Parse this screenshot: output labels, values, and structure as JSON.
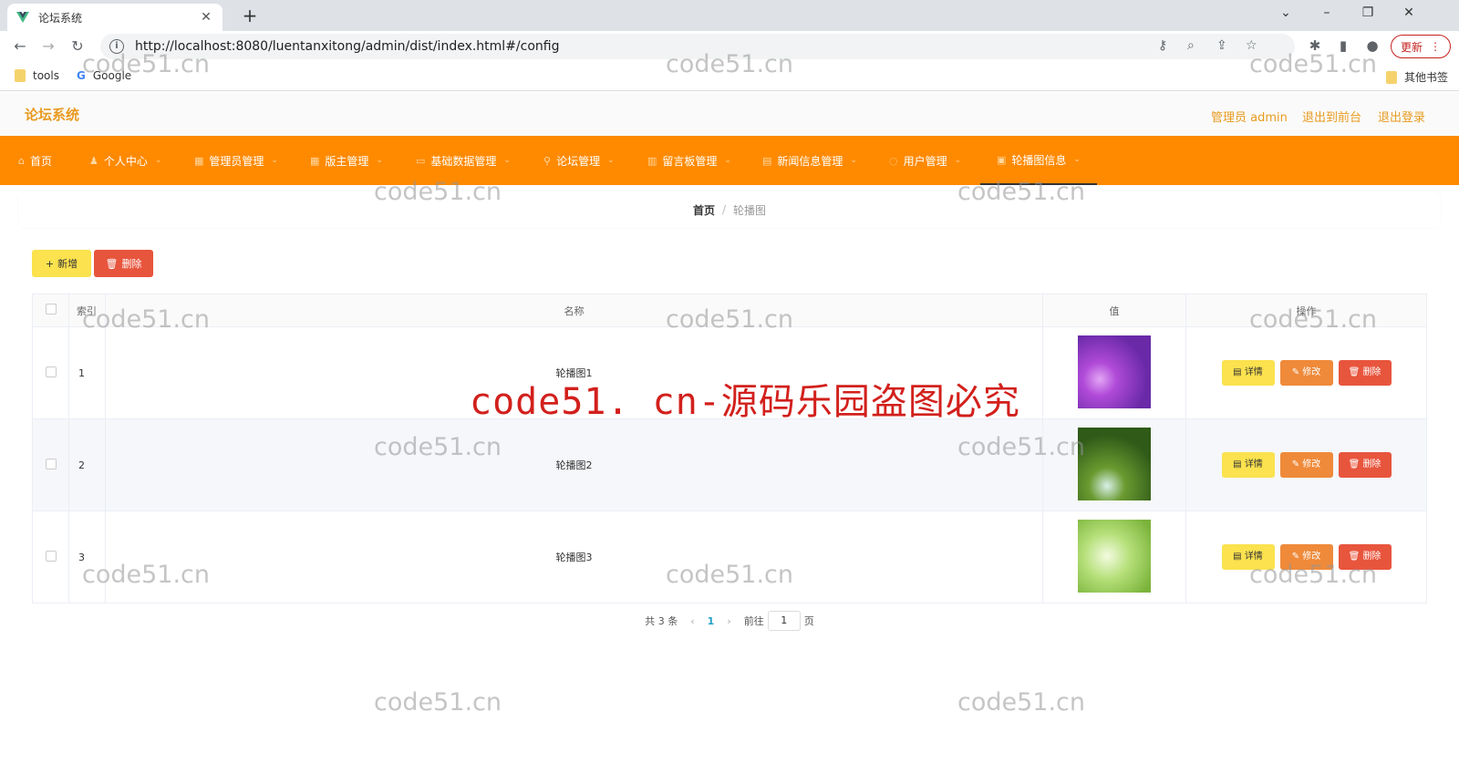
{
  "browser": {
    "tab_title": "论坛系统",
    "url": "http://localhost:8080/luentanxitong/admin/dist/index.html#/config",
    "update_label": "更新",
    "bookmarks": [
      {
        "label": "tools"
      },
      {
        "label": "Google"
      }
    ],
    "other_bookmarks": "其他书签"
  },
  "header": {
    "logo": "论坛系统",
    "links": [
      "管理员 admin",
      "退出到前台",
      "退出登录"
    ]
  },
  "menu": {
    "items": [
      {
        "label": "首页",
        "icon": "home-icon"
      },
      {
        "label": "个人中心",
        "icon": "user-icon"
      },
      {
        "label": "管理员管理",
        "icon": "grid-icon"
      },
      {
        "label": "版主管理",
        "icon": "grid-icon"
      },
      {
        "label": "基础数据管理",
        "icon": "doc-icon"
      },
      {
        "label": "论坛管理",
        "icon": "pin-icon"
      },
      {
        "label": "留言板管理",
        "icon": "chart-icon"
      },
      {
        "label": "新闻信息管理",
        "icon": "news-icon"
      },
      {
        "label": "用户管理",
        "icon": "circle-icon"
      },
      {
        "label": "轮播图信息",
        "icon": "image-icon"
      }
    ],
    "active_index": 9
  },
  "breadcrumb": {
    "home": "首页",
    "separator": "/",
    "current": "轮播图"
  },
  "toolbar": {
    "add_label": "新增",
    "delete_label": "删除"
  },
  "table": {
    "columns": [
      "索引",
      "名称",
      "值",
      "操作"
    ],
    "rows": [
      {
        "index": "1",
        "name": "轮播图1",
        "thumb_color": "#8a2fc0"
      },
      {
        "index": "2",
        "name": "轮播图2",
        "thumb_color": "#4f7d2a"
      },
      {
        "index": "3",
        "name": "轮播图3",
        "thumb_color": "#a8d66a"
      }
    ],
    "actions": {
      "detail": "详情",
      "edit": "修改",
      "delete": "删除"
    }
  },
  "pagination": {
    "total": "共 3 条",
    "prev": "‹",
    "page": "1",
    "next": "›",
    "goto_label": "前往",
    "goto_value": "1",
    "page_unit": "页"
  },
  "watermark": {
    "text": "code51.cn",
    "banner": "code51. cn-源码乐园盗图必究"
  }
}
